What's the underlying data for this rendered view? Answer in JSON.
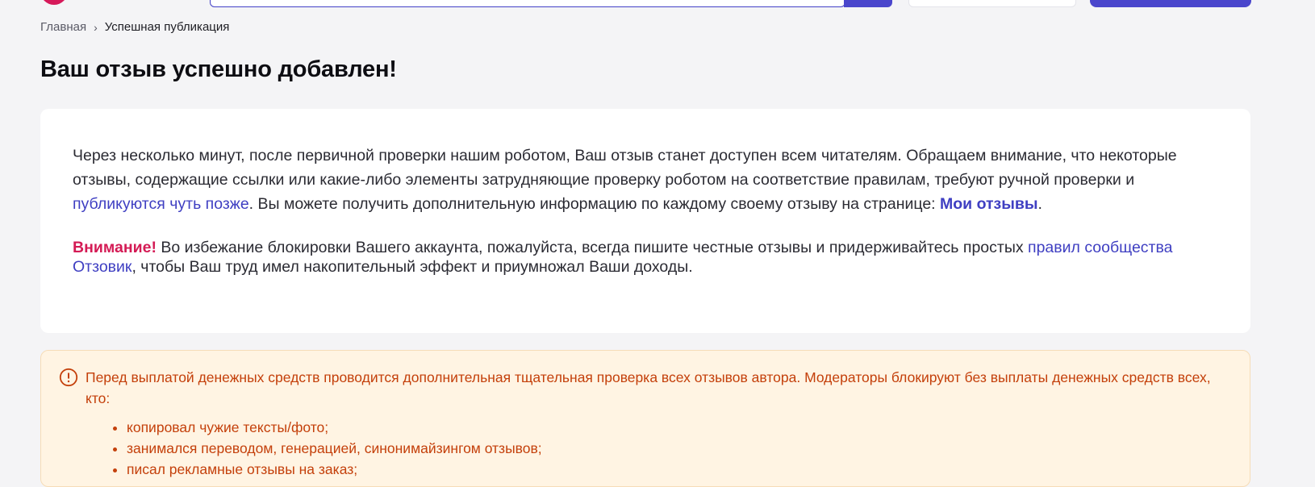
{
  "breadcrumb": {
    "home": "Главная",
    "separator": "›",
    "current": "Успешная публикация"
  },
  "page_title": "Ваш отзыв успешно добавлен!",
  "info": {
    "text_part1": "Через несколько минут, после первичной проверки нашим роботом, Ваш отзыв станет доступен всем читателям. Обращаем внимание, что некоторые отзывы, содержащие ссылки или какие-либо элементы затрудняющие проверку роботом на соответствие правилам, требуют ручной проверки и ",
    "link_later": "публикуются чуть позже",
    "text_part2": ". Вы можете получить дополнительную информацию по каждому своему отзыву на странице: ",
    "link_my_reviews": "Мои отзывы",
    "text_part3": "."
  },
  "warning": {
    "label": "Внимание!",
    "text_part1": " Во избежание блокировки Вашего аккаунта, пожалуйста, всегда пишите честные отзывы и придерживайтесь простых ",
    "link_rules": "правил сообщества Отзовик",
    "text_part2": ", чтобы Ваш труд имел накопительный эффект и приумножал Ваши доходы."
  },
  "alert": {
    "icon": "exclamation-circle-icon",
    "text": "Перед выплатой денежных средств проводится дополнительная тщательная проверка всех отзывов автора. Модераторы блокируют без выплаты денежных средств всех, кто:",
    "items": [
      "копировал чужие тексты/фото;",
      "занимался переводом, генерацией, синонимайзингом отзывов;",
      "писал рекламные отзывы на заказ;"
    ]
  },
  "colors": {
    "accent": "#4a46cc",
    "warning_label": "#d41b55",
    "alert_text": "#c4400b",
    "alert_background": "#fff4e3"
  }
}
